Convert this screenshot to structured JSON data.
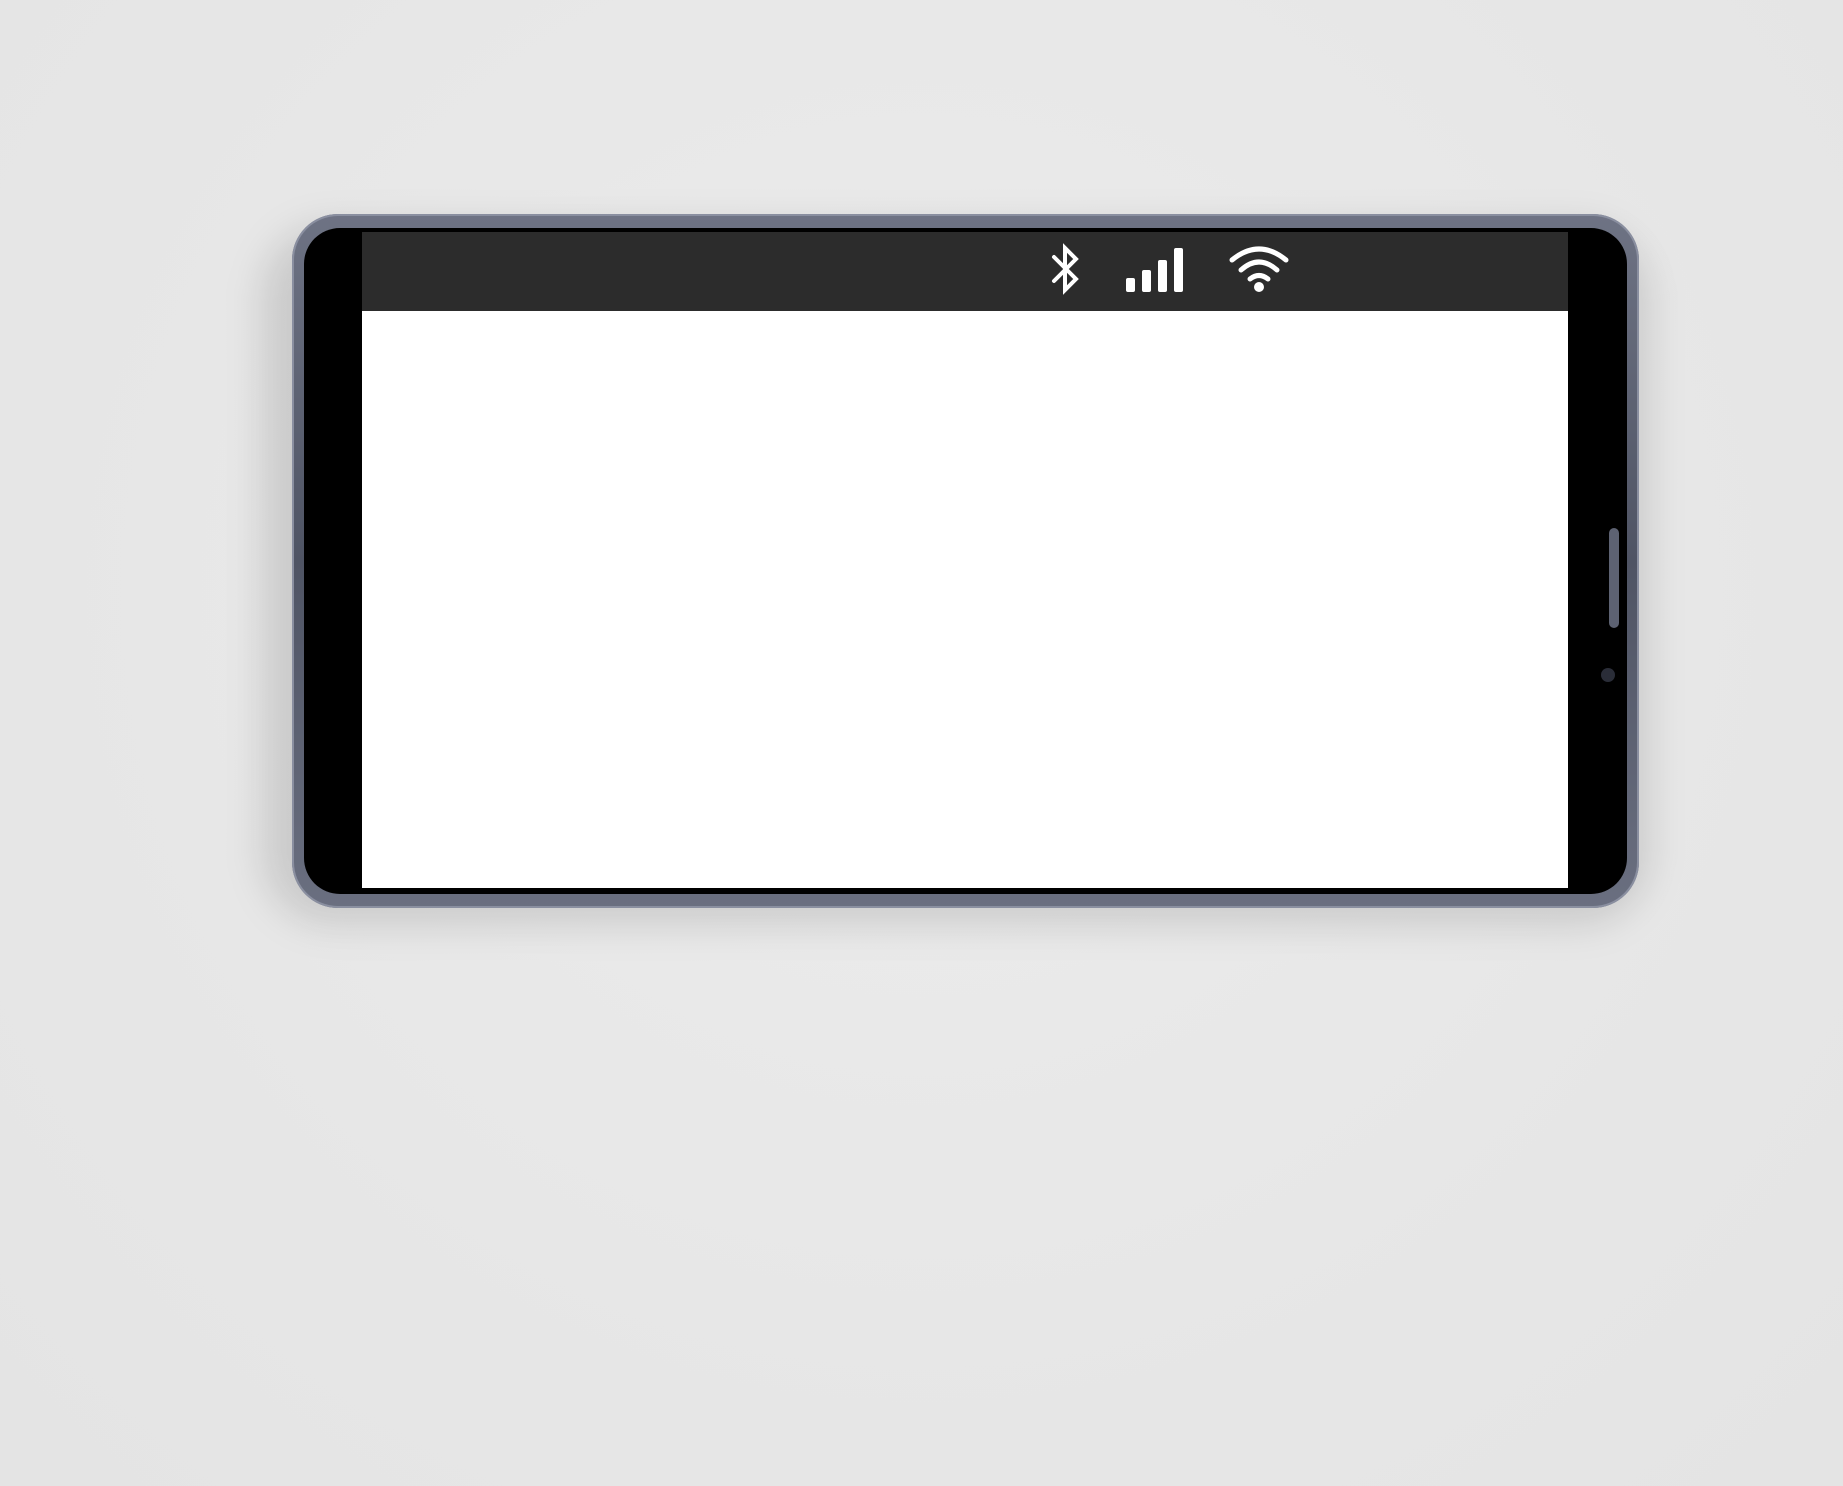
{
  "device": {
    "orientation": "landscape",
    "frame_color": "#5a5f70",
    "status_bar_color": "#2c2c2c",
    "screen_color": "#ffffff"
  },
  "status_bar": {
    "icons": [
      "bluetooth-icon",
      "cellular-signal-icon",
      "wifi-icon"
    ]
  }
}
